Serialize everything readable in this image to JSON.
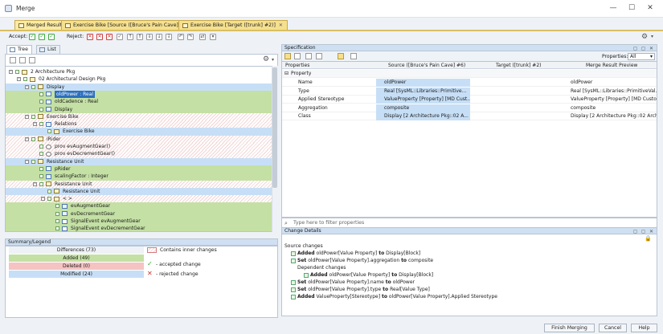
{
  "window": {
    "title": "Merge",
    "min": "—",
    "max": "☐",
    "close": "✕"
  },
  "tabs": [
    {
      "label": "Merged Result",
      "close": "✕"
    },
    {
      "label": "Exercise Bike [Source ([Bruce's Pain Cave] #6)]",
      "close": "✕"
    },
    {
      "label": "Exercise Bike [Target ([trunk] #2)]",
      "close": "✕"
    }
  ],
  "toolbar": {
    "accept_label": "Accept:",
    "reject_label": "Reject:"
  },
  "left_tabs": {
    "tree": "Tree",
    "list": "List"
  },
  "tree_rows": [
    {
      "label": "2 Architecture Pkg",
      "indent": 0,
      "style": "",
      "icon": "cls",
      "expander": "-"
    },
    {
      "label": "02 Architectural Design Pkg",
      "indent": 1,
      "style": "",
      "icon": "cls",
      "expander": "-"
    },
    {
      "label": "Display",
      "indent": 2,
      "style": "blue",
      "icon": "cls",
      "expander": "-"
    },
    {
      "label": "oldPower : Real",
      "indent": 3,
      "style": "green",
      "icon": "prop",
      "expander": "",
      "selected": true
    },
    {
      "label": "oldCadence : Real",
      "indent": 3,
      "style": "green",
      "icon": "prop",
      "expander": ""
    },
    {
      "label": "Display",
      "indent": 3,
      "style": "green",
      "icon": "prop",
      "expander": ""
    },
    {
      "label": "Exercise Bike",
      "indent": 2,
      "style": "hatch",
      "icon": "cls",
      "expander": "-"
    },
    {
      "label": "Relations",
      "indent": 3,
      "style": "hatch",
      "icon": "prop",
      "expander": "-"
    },
    {
      "label": "Exercise Bike",
      "indent": 4,
      "style": "blue",
      "icon": "cls",
      "expander": ""
    },
    {
      "label": "iRider",
      "indent": 2,
      "style": "hatch",
      "icon": "cls",
      "expander": "-"
    },
    {
      "label": "prov evAugmentGear()",
      "indent": 3,
      "style": "hatch",
      "icon": "circ",
      "expander": ""
    },
    {
      "label": "prov evDecrementGear()",
      "indent": 3,
      "style": "hatch",
      "icon": "circ",
      "expander": ""
    },
    {
      "label": "Resistance Unit",
      "indent": 2,
      "style": "blue",
      "icon": "cls",
      "expander": "-"
    },
    {
      "label": "pRider",
      "indent": 3,
      "style": "green",
      "icon": "prop",
      "expander": ""
    },
    {
      "label": "scalingFactor : Integer",
      "indent": 3,
      "style": "green",
      "icon": "prop",
      "expander": ""
    },
    {
      "label": "Resistance Unit",
      "indent": 3,
      "style": "hatch",
      "icon": "cls",
      "expander": "-"
    },
    {
      "label": "Resistance Unit",
      "indent": 4,
      "style": "blue",
      "icon": "cls",
      "expander": ""
    },
    {
      "label": "< >",
      "indent": 4,
      "style": "hatch",
      "icon": "cls",
      "expander": "-"
    },
    {
      "label": "evAugmentGear",
      "indent": 5,
      "style": "green",
      "icon": "prop",
      "expander": ""
    },
    {
      "label": "evDecrementGear",
      "indent": 5,
      "style": "green",
      "icon": "prop",
      "expander": ""
    },
    {
      "label": "SignalEvent evAugmentGear",
      "indent": 5,
      "style": "green",
      "icon": "chk",
      "expander": ""
    },
    {
      "label": "SignalEvent evDecrementGear",
      "indent": 5,
      "style": "green",
      "icon": "chk",
      "expander": ""
    }
  ],
  "summary": {
    "title": "Summary/Legend",
    "differences": "Differences (73)",
    "added": "Added (49)",
    "deleted": "Deleted (0)",
    "modified": "Modified (24)",
    "inner_changes": "Contains inner changes",
    "accepted": "- accepted change",
    "rejected": "- rejected change"
  },
  "specification": {
    "title": "Specification",
    "properties_label": "Properties:",
    "properties_value": "All",
    "columns": [
      "Properties",
      "Source ([Bruce's Pain Cave] #6)",
      "Target ([trunk] #2)",
      "Merge Result Preview"
    ],
    "group": "Property",
    "rows": [
      {
        "name": "Name",
        "source": "oldPower",
        "target": "",
        "result": "oldPower"
      },
      {
        "name": "Type",
        "source": "Real [SysML::Libraries::Primitive...",
        "target": "",
        "result": "Real [SysML::Libraries::PrimitiveVal..."
      },
      {
        "name": "Applied Stereotype",
        "source": "ValueProperty [Property] [MD Cust...",
        "target": "",
        "result": "ValueProperty [Property] [MD Customiz..."
      },
      {
        "name": "Aggregation",
        "source": "composite",
        "target": "",
        "result": "composite"
      },
      {
        "name": "Class",
        "source": "Display [2 Architecture Pkg::02 A...",
        "target": "",
        "result": "Display [2 Architecture Pkg::02 Archi..."
      }
    ],
    "filter_placeholder": "Type here to filter properties"
  },
  "change_details": {
    "title": "Change Details",
    "source_changes": "Source changes",
    "lines": [
      {
        "verb": "Added",
        "text": "oldPower[Value Property]",
        "mid": "to",
        "target": "Display[Block]",
        "indent": 1
      },
      {
        "verb": "Set",
        "text": "oldPower[Value Property].aggregation",
        "mid": "to",
        "target": "composite",
        "indent": 1
      },
      {
        "verb": "",
        "text": "Dependent changes",
        "mid": "",
        "target": "",
        "indent": 2
      },
      {
        "verb": "Added",
        "text": "oldPower[Value Property]",
        "mid": "to",
        "target": "Display[Block]",
        "indent": 3
      },
      {
        "verb": "Set",
        "text": "oldPower[Value Property].name",
        "mid": "to",
        "target": "oldPower",
        "indent": 1
      },
      {
        "verb": "Set",
        "text": "oldPower[Value Property].type",
        "mid": "to",
        "target": "Real[Value Type]",
        "indent": 1
      },
      {
        "verb": "Added",
        "text": "ValueProperty[Stereotype]",
        "mid": "to",
        "target": "oldPower[Value Property].Applied Stereotype",
        "indent": 1
      }
    ]
  },
  "footer": {
    "finish": "Finish Merging",
    "cancel": "Cancel",
    "help": "Help"
  },
  "colors": {
    "added": "#c4e0a4",
    "deleted": "#f6c3c3",
    "modified": "#c7dff6",
    "accent": "#2d6fbd"
  }
}
